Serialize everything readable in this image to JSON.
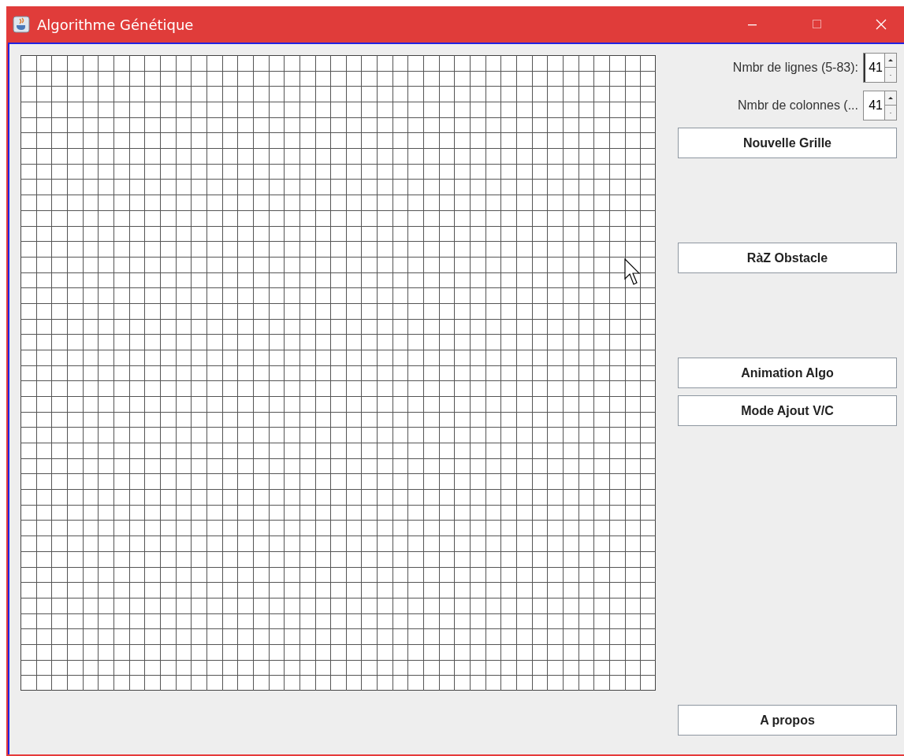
{
  "window": {
    "title": "Algorithme Génétique"
  },
  "spinners": [
    {
      "label": "Nmbr de lignes (5-83):",
      "value": "41",
      "focused": true
    },
    {
      "label": "Nmbr de colonnes (...",
      "value": "41",
      "focused": false
    }
  ],
  "new_grid_button": "Nouvelle Grille",
  "reset_button": "RàZ Obstacle",
  "algo_buttons": [
    "Animation Algo",
    "Mode Ajout V/C"
  ],
  "about_button": "A propos"
}
